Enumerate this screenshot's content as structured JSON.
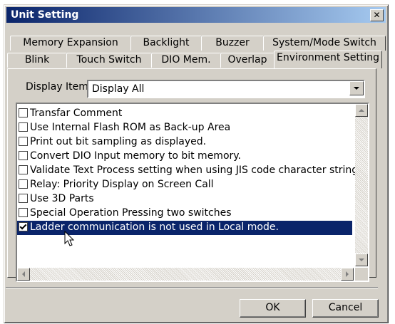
{
  "window": {
    "title": "Unit Setting",
    "close_symbol": "✕"
  },
  "tabs_row1": [
    "Memory Expansion",
    "Backlight",
    "Buzzer",
    "System/Mode Switch"
  ],
  "tabs_row2": [
    "Blink",
    "Touch Switch",
    "DIO Mem.",
    "Overlap",
    "Environment Setting"
  ],
  "active_tab": "Environment Setting",
  "display_item": {
    "label": "Display Item",
    "value": "Display All"
  },
  "options": [
    {
      "label": "Transfar Comment",
      "checked": false,
      "selected": false
    },
    {
      "label": "Use Internal Flash ROM as Back-up Area",
      "checked": false,
      "selected": false
    },
    {
      "label": "Print out bit sampling as displayed.",
      "checked": false,
      "selected": false
    },
    {
      "label": "Convert DIO Input memory to bit memory.",
      "checked": false,
      "selected": false
    },
    {
      "label": "Validate Text Process setting when using JIS code character strings.",
      "checked": false,
      "selected": false
    },
    {
      "label": "Relay: Priority Display on Screen Call",
      "checked": false,
      "selected": false
    },
    {
      "label": "Use 3D Parts",
      "checked": false,
      "selected": false
    },
    {
      "label": "Special Operation Pressing two switches",
      "checked": false,
      "selected": false
    },
    {
      "label": "Ladder communication is not used in Local mode.",
      "checked": true,
      "selected": true
    }
  ],
  "buttons": {
    "ok": "OK",
    "cancel": "Cancel"
  }
}
